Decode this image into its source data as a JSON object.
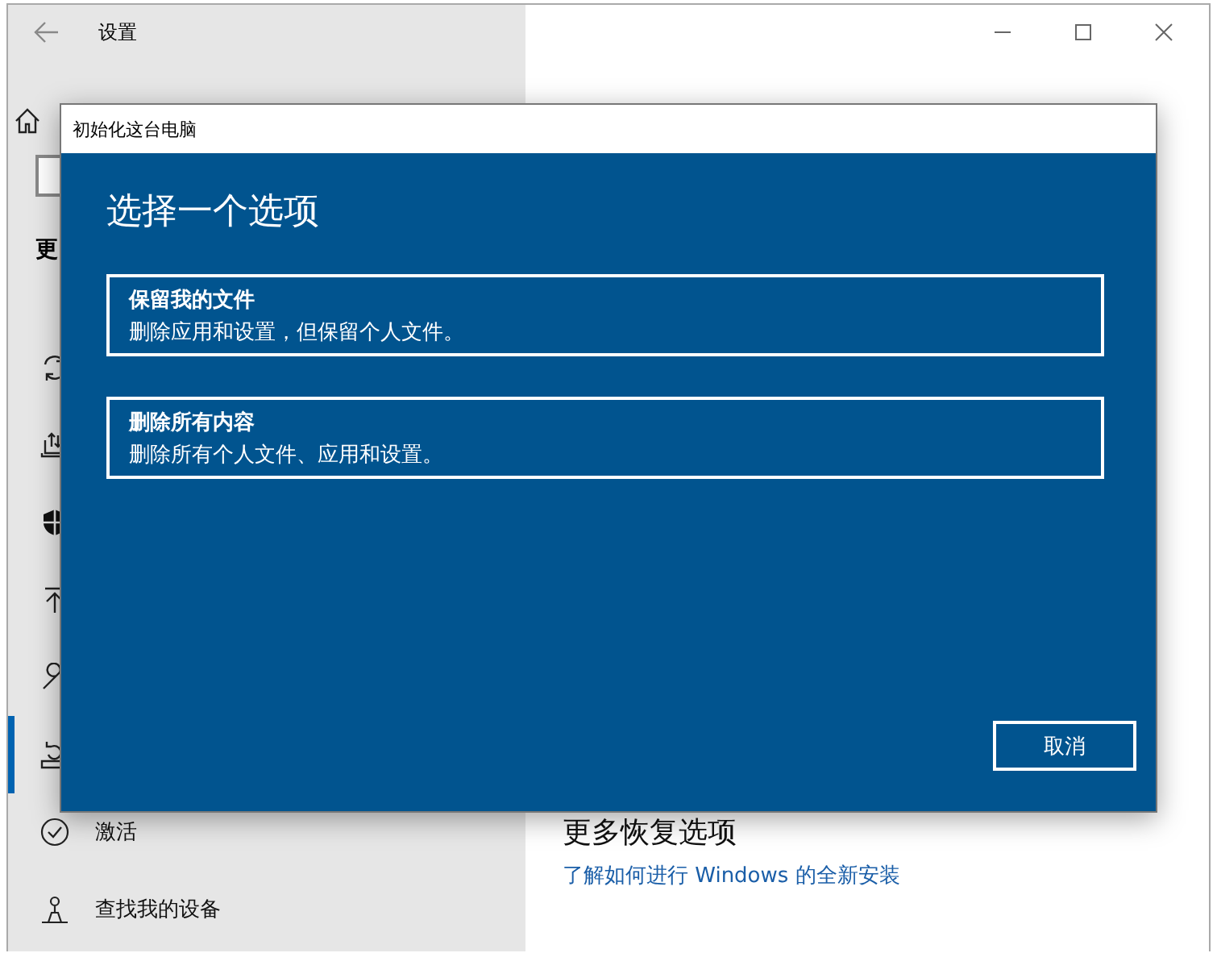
{
  "window": {
    "title": "设置"
  },
  "sidebar": {
    "section_heading": "更",
    "items": [
      {
        "selected": false
      },
      {
        "selected": false
      },
      {
        "selected": false
      },
      {
        "selected": false
      },
      {
        "selected": false
      },
      {
        "selected": true
      },
      {
        "label": "激活",
        "selected": false
      },
      {
        "label": "查找我的设备",
        "selected": false
      }
    ]
  },
  "content": {
    "section_heading": "更多恢复选项",
    "link": "了解如何进行 Windows 的全新安装"
  },
  "dialog": {
    "title": "初始化这台电脑",
    "heading": "选择一个选项",
    "options": [
      {
        "title": "保留我的文件",
        "description": "删除应用和设置，但保留个人文件。"
      },
      {
        "title": "删除所有内容",
        "description": "删除所有个人文件、应用和设置。"
      }
    ],
    "cancel_button": "取消"
  }
}
